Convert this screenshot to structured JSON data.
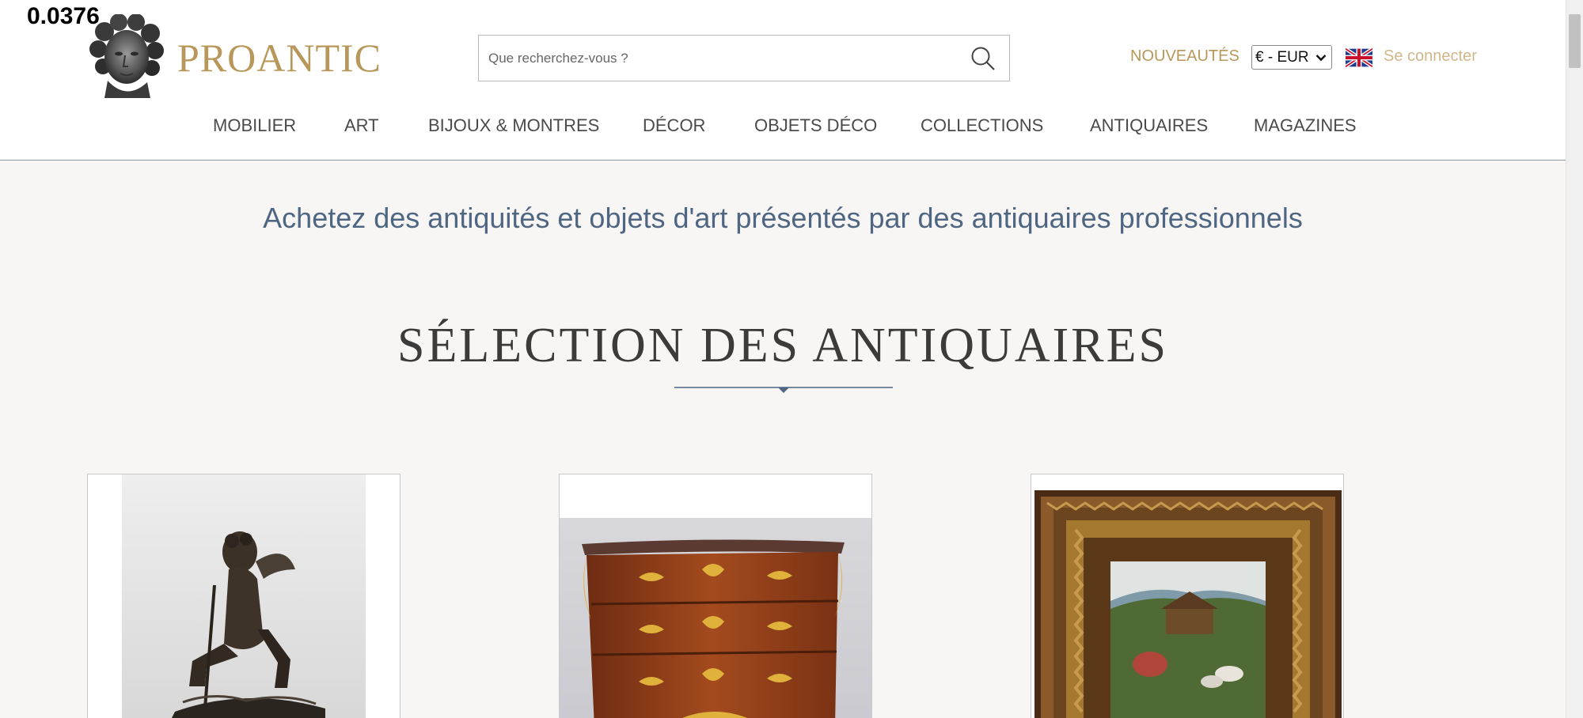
{
  "overlay": {
    "score": "0.0376"
  },
  "header": {
    "logo_text": "PROANTIC",
    "search": {
      "placeholder": "Que recherchez-vous ?"
    },
    "links": {
      "new": "NOUVEAUTÉS",
      "login": "Se connecter"
    },
    "currency": {
      "selected": "€ - EUR"
    }
  },
  "nav": {
    "items": [
      {
        "label": "MOBILIER"
      },
      {
        "label": "ART"
      },
      {
        "label": "BIJOUX & MONTRES"
      },
      {
        "label": "DÉCOR"
      },
      {
        "label": "OBJETS DÉCO"
      },
      {
        "label": "COLLECTIONS"
      },
      {
        "label": "ANTIQUAIRES"
      },
      {
        "label": "MAGAZINES"
      }
    ]
  },
  "main": {
    "tagline": "Achetez des antiquités et objets d'art présentés par des antiquaires professionnels",
    "section_title": "SÉLECTION DES ANTIQUAIRES"
  },
  "colors": {
    "gold": "#b8975a",
    "navy": "#4f6682",
    "background": "#f7f6f4"
  }
}
